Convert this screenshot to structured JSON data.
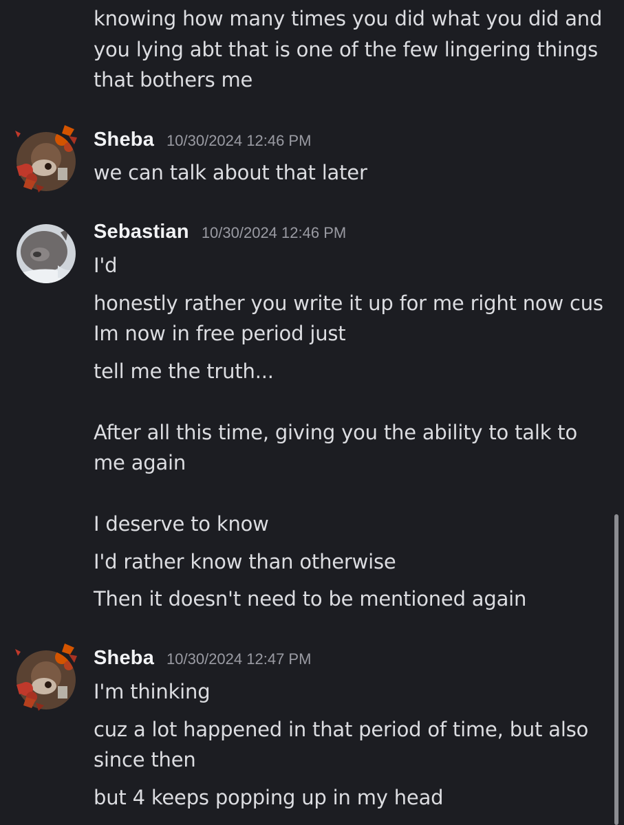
{
  "top_continuation": [
    "knowing how many times you did what you did and",
    "you lying abt that is one of the few lingering things",
    "that bothers me"
  ],
  "messages": [
    {
      "author": "Sheba",
      "timestamp": "10/30/2024 12:46 PM",
      "lines": [
        "we can talk about that later"
      ]
    },
    {
      "author": "Sebastian",
      "timestamp": "10/30/2024 12:46 PM",
      "lines": [
        "I'd",
        "honestly rather you write it up for me right now cus",
        "Im now in free period just",
        "tell me the truth...",
        "After all this time, giving you the ability to talk to",
        "me again",
        "I deserve to know",
        "I'd rather know than otherwise",
        "Then it doesn't need to be mentioned again"
      ]
    },
    {
      "author": "Sheba",
      "timestamp": "10/30/2024 12:47 PM",
      "lines": [
        "I'm thinking",
        "cuz a lot happened in that period of time, but also",
        "since then",
        "but 4 keeps popping up in my head"
      ]
    }
  ],
  "colors": {
    "background": "#1c1d22",
    "text": "#dcdde1",
    "username": "#f2f3f5",
    "timestamp": "#9a9ba3",
    "scrollbar": "#8c8d92"
  }
}
